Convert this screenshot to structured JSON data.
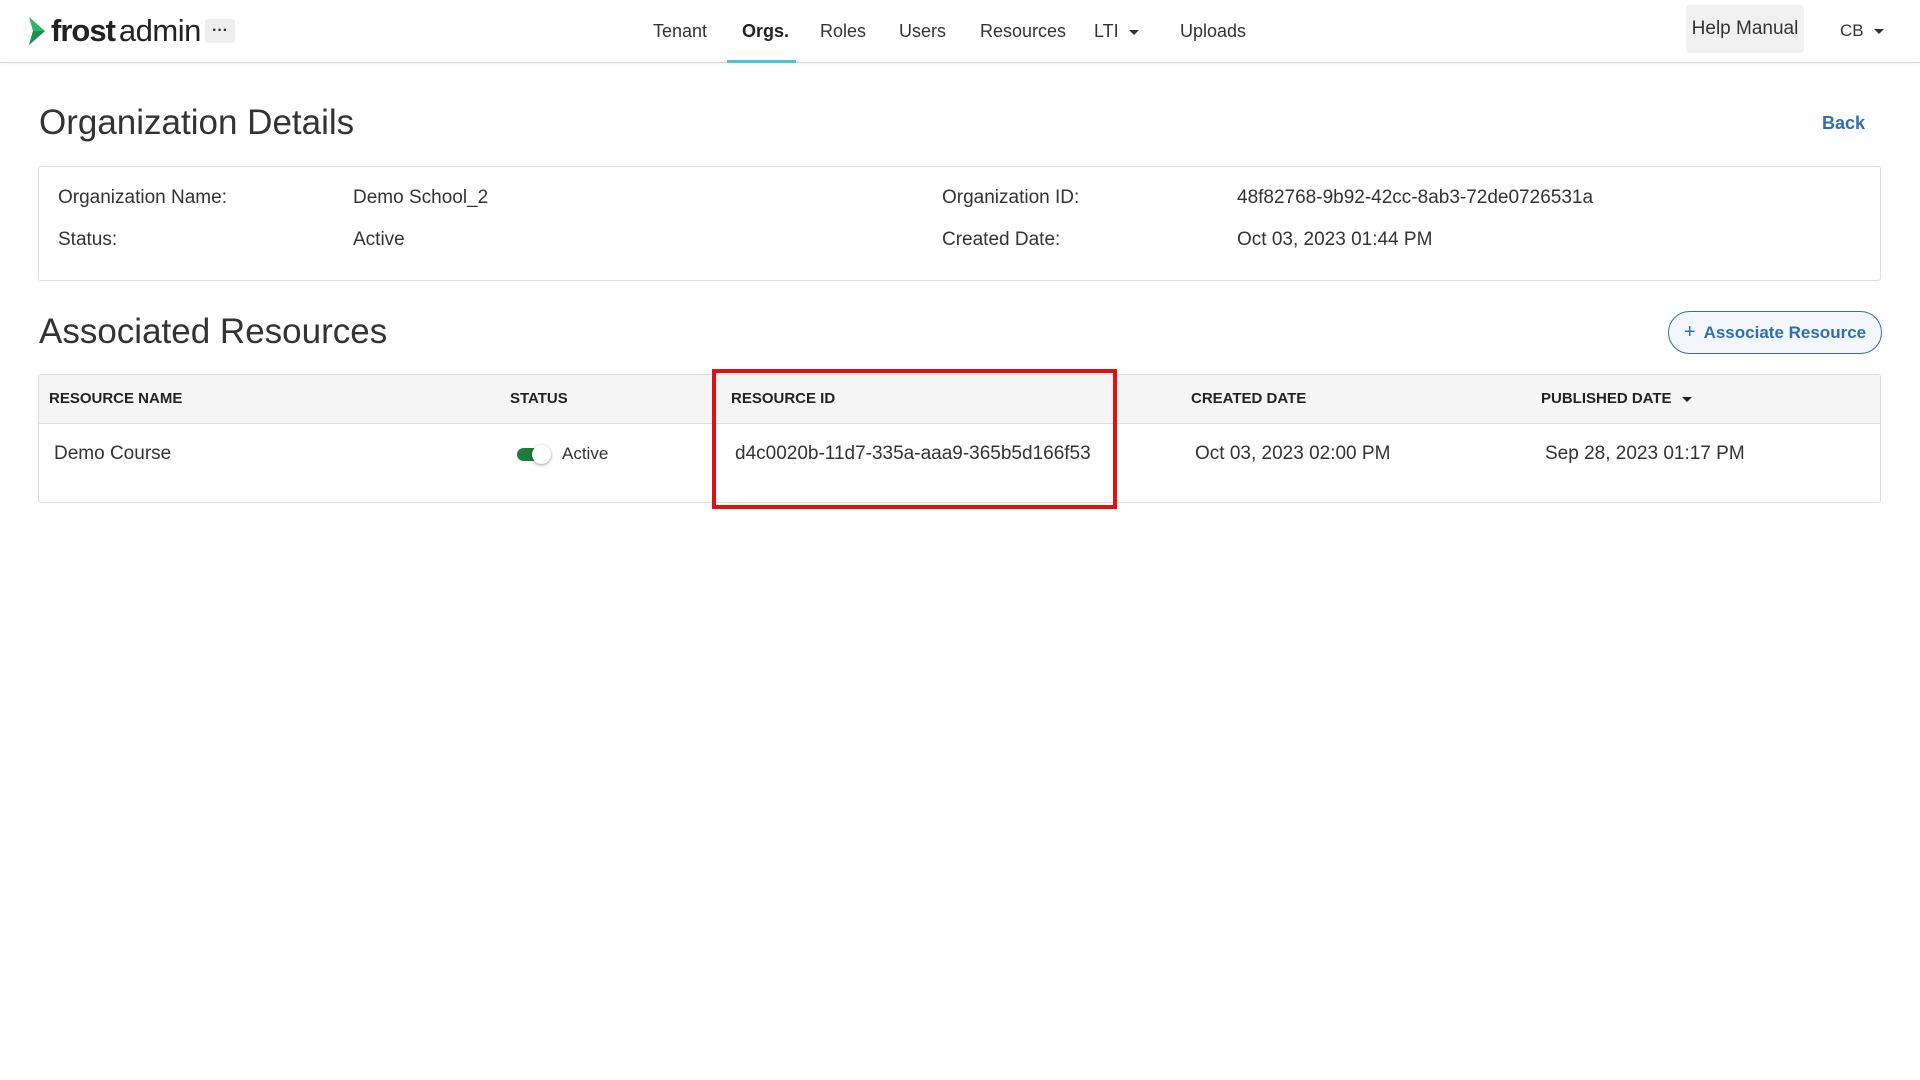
{
  "header": {
    "brand_primary": "frost",
    "brand_secondary": "admin",
    "more_label": "···",
    "nav": [
      {
        "label": "Tenant"
      },
      {
        "label": "Orgs."
      },
      {
        "label": "Roles"
      },
      {
        "label": "Users"
      },
      {
        "label": "Resources"
      },
      {
        "label": "LTI"
      },
      {
        "label": "Uploads"
      }
    ],
    "active_tab": "Orgs.",
    "help_label": "Help Manual",
    "user_initials": "CB"
  },
  "page": {
    "title": "Organization Details",
    "back_label": "Back"
  },
  "details": {
    "org_name_label": "Organization Name:",
    "org_name_value": "Demo School_2",
    "status_label": "Status:",
    "status_value": "Active",
    "org_id_label": "Organization ID:",
    "org_id_value": "48f82768-9b92-42cc-8ab3-72de0726531a",
    "created_label": "Created Date:",
    "created_value": "Oct 03, 2023 01:44 PM"
  },
  "resources": {
    "title": "Associated Resources",
    "associate_label": "Associate Resource",
    "columns": [
      "RESOURCE NAME",
      "STATUS",
      "RESOURCE ID",
      "CREATED DATE",
      "PUBLISHED DATE"
    ],
    "rows": [
      {
        "name": "Demo Course",
        "status": "Active",
        "status_on": true,
        "resource_id": "d4c0020b-11d7-335a-aaa9-365b5d166f53",
        "created": "Oct 03, 2023 02:00 PM",
        "published": "Sep 28, 2023 01:17 PM"
      }
    ]
  },
  "colors": {
    "accent": "#4dc6d2",
    "link": "#2e6fb2",
    "toggle_on": "#1e7d3c",
    "highlight": "#e11111",
    "logo_green": "#2fb56a"
  }
}
